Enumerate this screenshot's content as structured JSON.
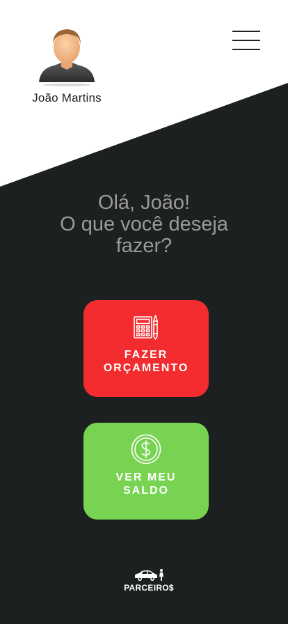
{
  "user": {
    "name": "João Martins"
  },
  "greeting": {
    "line1": "Olá, João!",
    "line2": "O que você deseja",
    "line3": "fazer?"
  },
  "actions": {
    "budget": {
      "line1": "FAZER",
      "line2": "ORÇAMENTO",
      "icon": "calculator-icon",
      "color": "#f32c2f"
    },
    "balance": {
      "line1": "VER MEU",
      "line2": "SALDO",
      "icon": "dollar-coin-icon",
      "color": "#79d353"
    }
  },
  "brand": {
    "name": "PARCEIRO$",
    "icon": "car-with-person-icon"
  },
  "icons": {
    "menu": "hamburger-menu-icon",
    "avatar": "user-avatar-icon"
  },
  "colors": {
    "dark": "#1d2020",
    "greeting_text": "#9a9a98"
  }
}
